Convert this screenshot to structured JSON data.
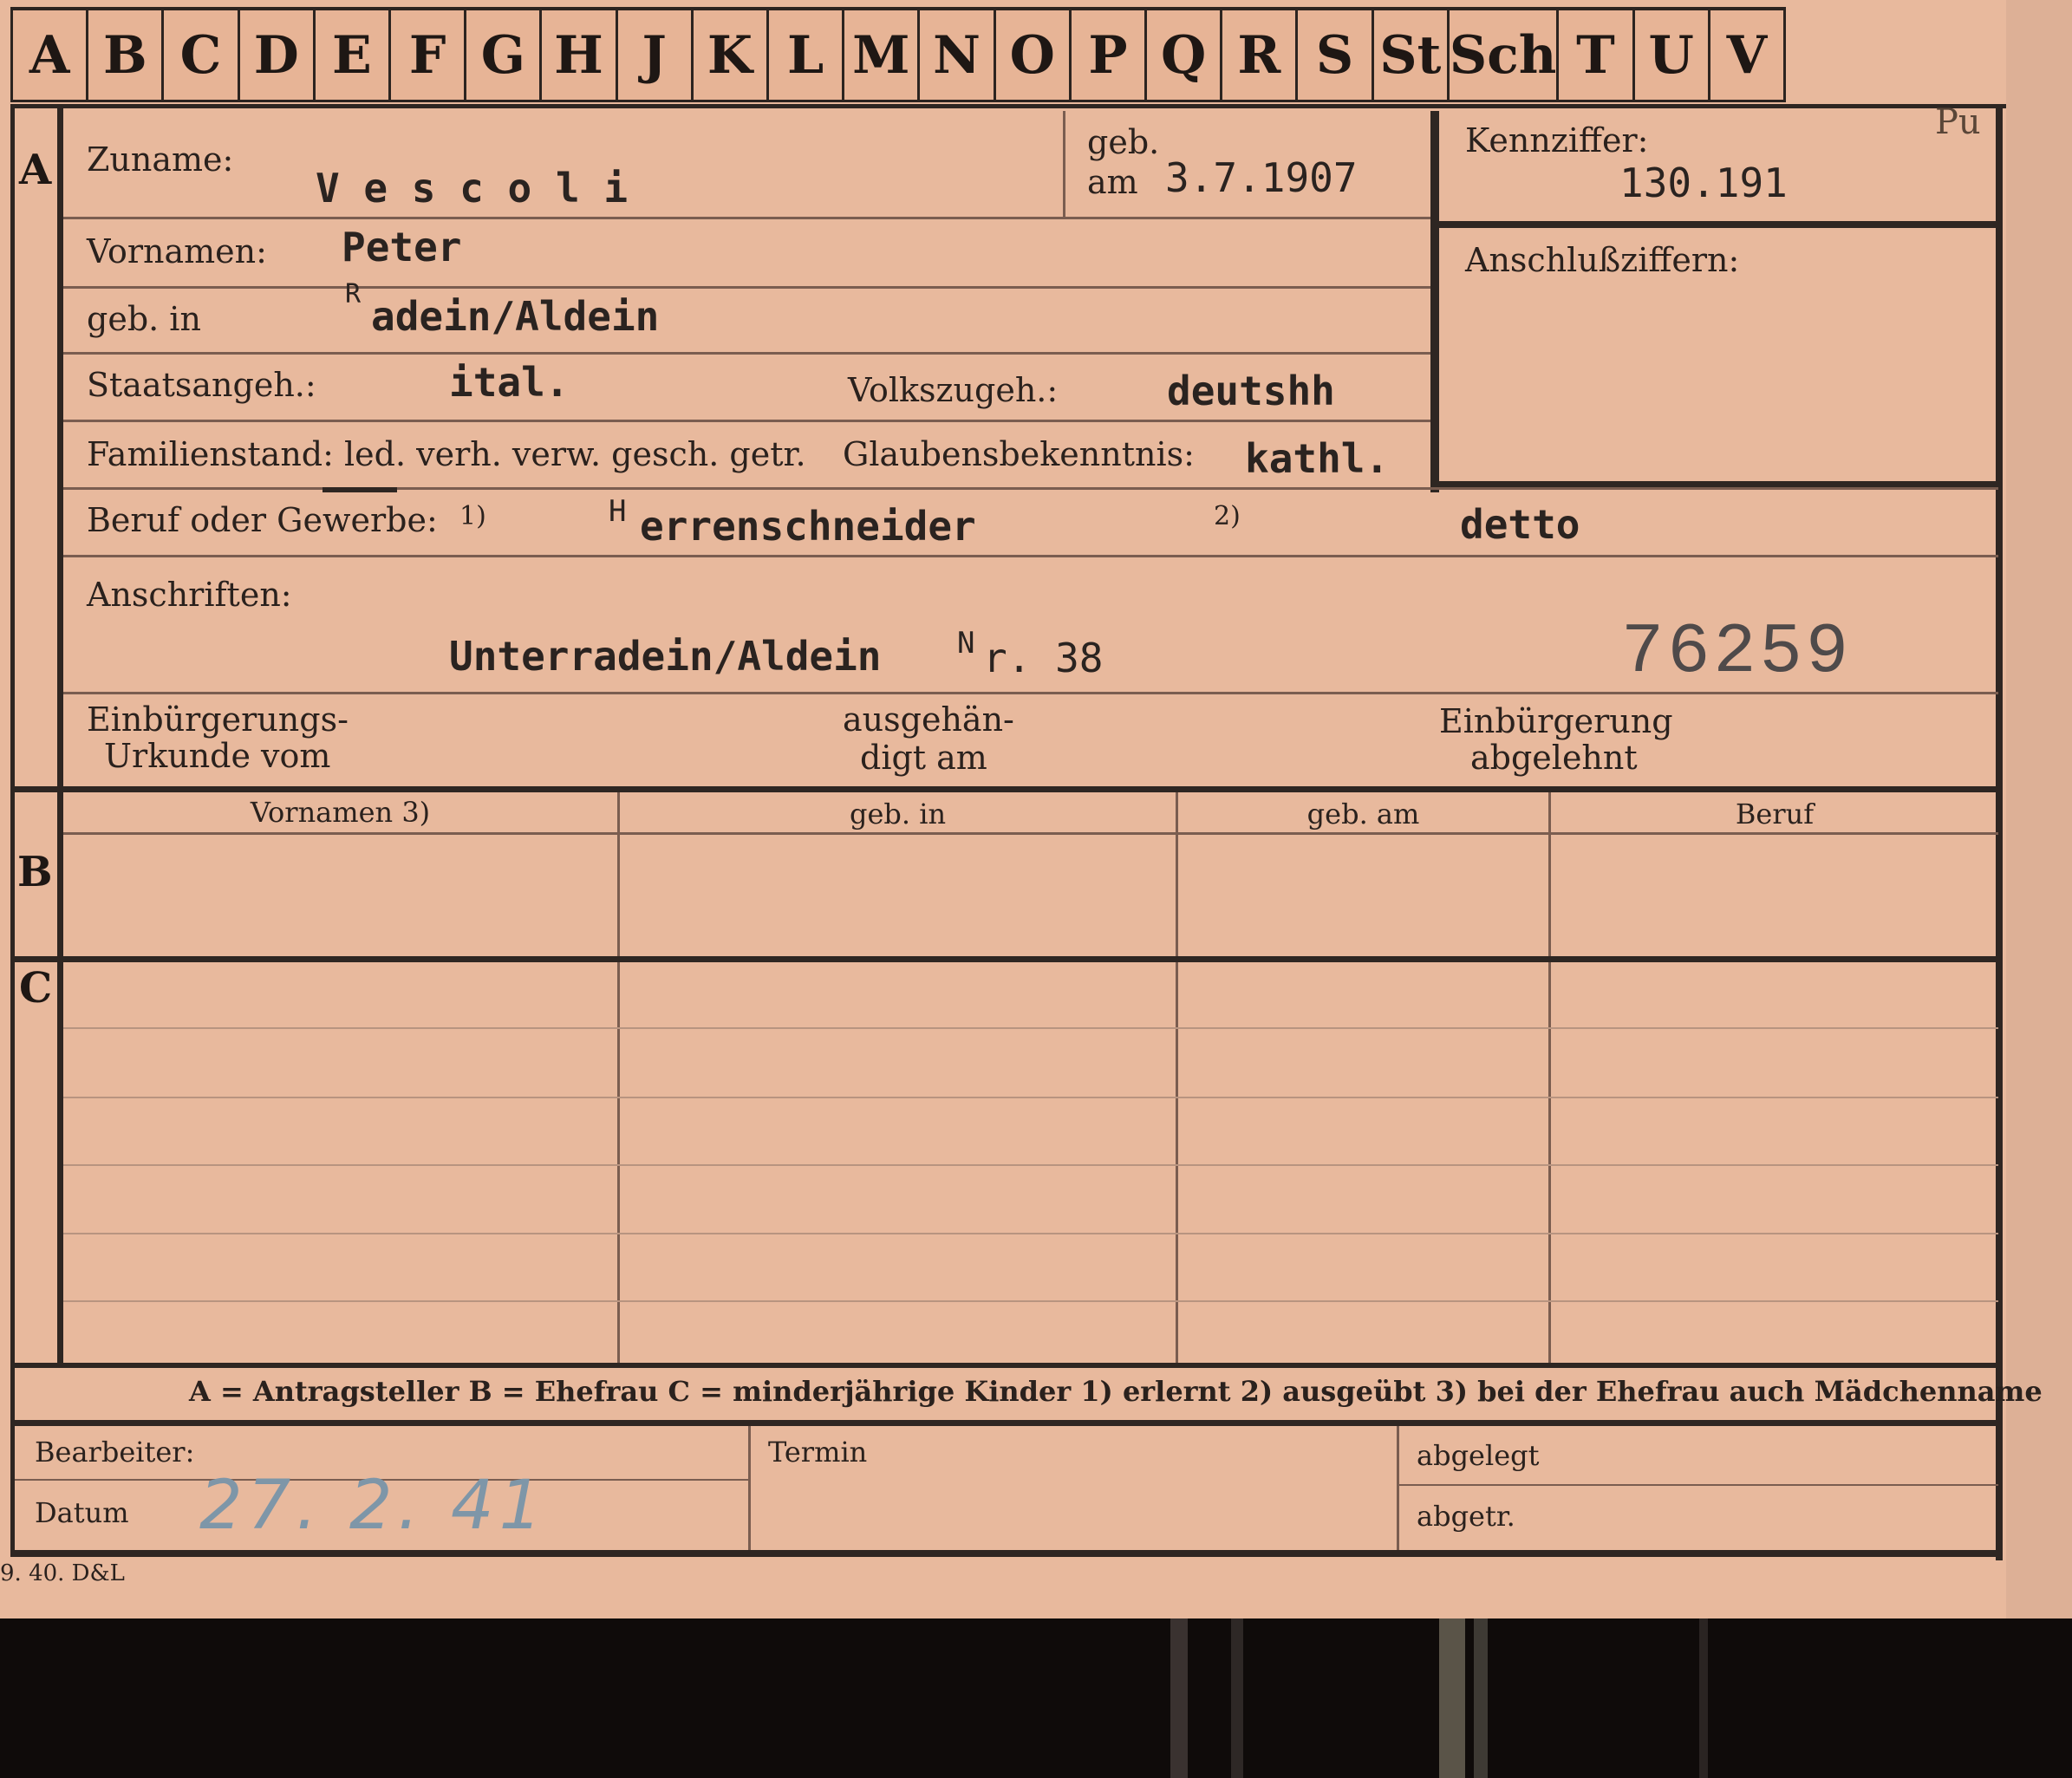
{
  "tabs": [
    "A",
    "B",
    "C",
    "D",
    "E",
    "F",
    "G",
    "H",
    "J",
    "K",
    "L",
    "M",
    "N",
    "O",
    "P",
    "Q",
    "R",
    "S",
    "St",
    "Sch",
    "T",
    "U",
    "V"
  ],
  "sections": {
    "a": "A",
    "b": "B",
    "c": "C"
  },
  "corner_mark": "Pu",
  "fields": {
    "zuname_label": "Zuname:",
    "zuname_value": "V e s c o l i",
    "geb_label_top": "geb.",
    "geb_label_bottom": "am",
    "geb_value": "3.7.1907",
    "kennziffer_label": "Kennziffer:",
    "kennziffer_value": "130.191",
    "anschluss_label": "Anschlußziffern:",
    "vornamen_label": "Vornamen:",
    "vornamen_value": "Peter",
    "gebin_label": "geb. in",
    "gebin_prefix": "R",
    "gebin_value": "adein/Aldein",
    "staat_label": "Staatsangeh.:",
    "staat_value": "ital.",
    "volk_label": "Volkszugeh.:",
    "volk_value": "deutshh",
    "familien_label": "Familienstand: led. verh. verw. gesch. getr.",
    "glauben_label": "Glaubensbekenntnis:",
    "glauben_value": "kathl.",
    "beruf_label": "Beruf oder Gewerbe:",
    "beruf_note1": "1)",
    "beruf_prefix": "H",
    "beruf_value": "errenschneider",
    "beruf_note2": "2)",
    "beruf_value2": "detto",
    "anschriften_label": "Anschriften:",
    "anschrift_value": "Unterradein/Aldein",
    "anschrift_nr_prefix": "N",
    "anschrift_nr": "r. 38",
    "stamp_number": "76259",
    "einb_urkunde_1": "Einbürgerungs-",
    "einb_urkunde_2": "Urkunde vom",
    "ausgehaen_1": "ausgehän-",
    "ausgehaen_2": "digt am",
    "einb_abgelehnt_1": "Einbürgerung",
    "einb_abgelehnt_2": "abgelehnt"
  },
  "table_headers": [
    "Vornamen 3)",
    "geb. in",
    "geb. am",
    "Beruf"
  ],
  "legend": "A = Antragsteller   B = Ehefrau   C = minderjährige Kinder   1) erlernt   2) ausgeübt   3) bei der Ehefrau auch Mädchenname",
  "footer": {
    "bearbeiter_label": "Bearbeiter:",
    "datum_label": "Datum",
    "datum_value": "27. 2. 41",
    "termin_label": "Termin",
    "abgelegt_label": "abgelegt",
    "abgetr_label": "abgetr."
  },
  "printer_mark": "9. 40. D&L"
}
